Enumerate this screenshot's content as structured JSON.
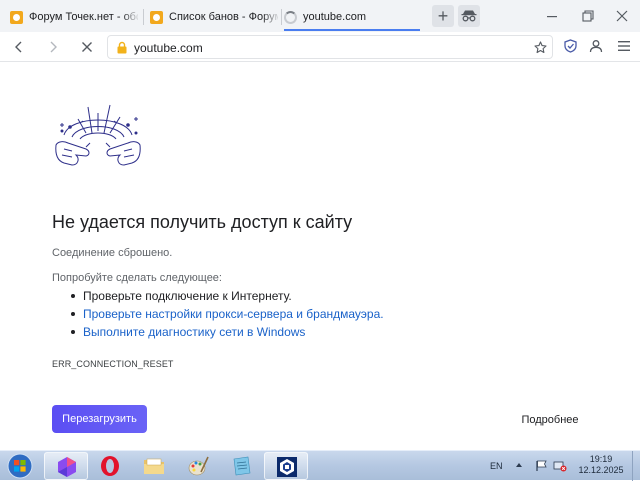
{
  "tabs": [
    {
      "title": "Форум Точек.нет - обс",
      "icon": "forum-favicon-icon"
    },
    {
      "title": "Список банов - Форум",
      "icon": "forum-favicon-icon"
    },
    {
      "title": "youtube.com",
      "icon": "loading-spinner-icon",
      "active": true
    }
  ],
  "window_controls": {
    "new_tab": "+"
  },
  "address_bar": {
    "url": "youtube.com"
  },
  "error_page": {
    "title": "Не удается получить доступ к сайту",
    "description": "Соединение сброшено.",
    "suggestions_heading": "Попробуйте сделать следующее:",
    "suggestions": [
      {
        "text": "Проверьте подключение к Интернету.",
        "link": false
      },
      {
        "text": "Проверьте настройки прокси-сервера и брандмауэра.",
        "link": true
      },
      {
        "text": "Выполните диагностику сети в Windows",
        "link": true
      }
    ],
    "error_code": "ERR_CONNECTION_RESET",
    "reload_button": "Перезагрузить",
    "details_button": "Подробнее"
  },
  "taskbar": {
    "language": "EN",
    "time": "19:19",
    "date": "12.12.2025",
    "apps": [
      "start-orb-icon",
      "browser-app-icon",
      "opera-icon",
      "folder-icon",
      "paint-icon",
      "notes-icon",
      "network-app-icon"
    ]
  },
  "colors": {
    "accent": "#5b4ef3",
    "link": "#1a62c9",
    "tab_indicator": "#4a7df0",
    "taskbar": "#b5c8e2"
  }
}
